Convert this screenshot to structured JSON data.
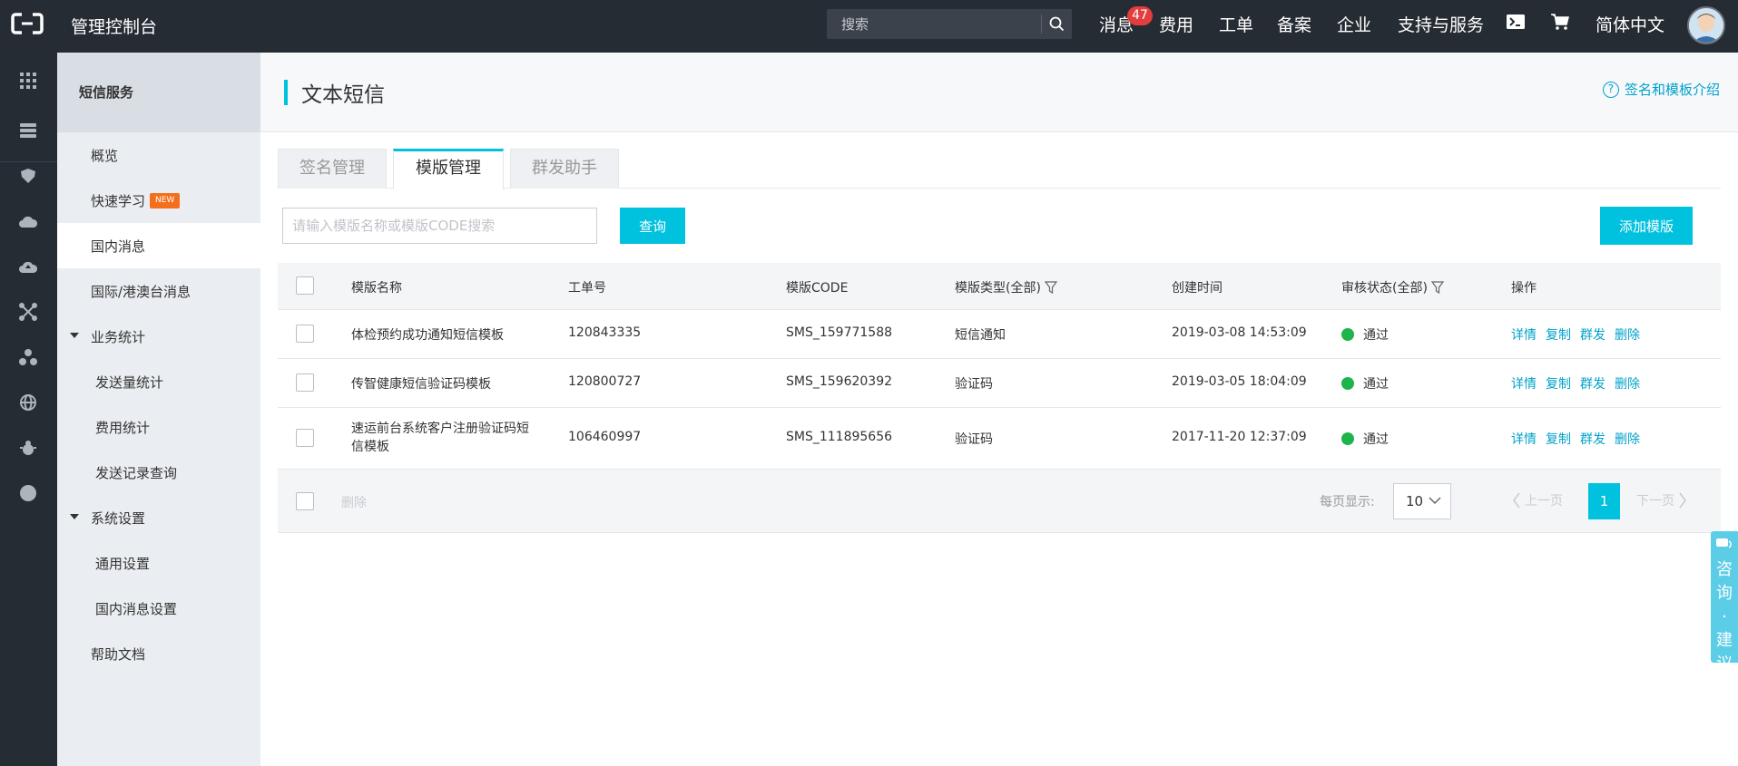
{
  "topbar": {
    "title": "管理控制台",
    "search_placeholder": "搜索",
    "nav": {
      "messages": "消息",
      "messages_count": "47",
      "billing": "费用",
      "tickets": "工单",
      "icp": "备案",
      "enterprise": "企业",
      "support": "支持与服务",
      "language": "简体中文"
    }
  },
  "sidebar": {
    "header": "短信服务",
    "items": [
      {
        "label": "概览"
      },
      {
        "label": "快速学习",
        "badge": "NEW"
      },
      {
        "label": "国内消息"
      },
      {
        "label": "国际/港澳台消息"
      },
      {
        "label": "业务统计"
      },
      {
        "label": "发送量统计"
      },
      {
        "label": "费用统计"
      },
      {
        "label": "发送记录查询"
      },
      {
        "label": "系统设置"
      },
      {
        "label": "通用设置"
      },
      {
        "label": "国内消息设置"
      },
      {
        "label": "帮助文档"
      }
    ]
  },
  "main": {
    "title": "文本短信",
    "help_link": "签名和模板介绍",
    "tabs": [
      "签名管理",
      "模版管理",
      "群发助手"
    ],
    "search_placeholder": "请输入模版名称或模版CODE搜索",
    "query_button": "查询",
    "add_button": "添加模版",
    "table": {
      "headers": [
        "模版名称",
        "工单号",
        "模版CODE",
        "模版类型(全部)",
        "创建时间",
        "审核状态(全部)",
        "操作"
      ],
      "rows": [
        {
          "name": "体检预约成功通知短信模板",
          "ticket": "120843335",
          "code": "SMS_159771588",
          "type": "短信通知",
          "created": "2019-03-08 14:53:09",
          "status": "通过"
        },
        {
          "name": "传智健康短信验证码模板",
          "ticket": "120800727",
          "code": "SMS_159620392",
          "type": "验证码",
          "created": "2019-03-05 18:04:09",
          "status": "通过"
        },
        {
          "name": "速运前台系统客户注册验证码短信模板",
          "ticket": "106460997",
          "code": "SMS_111895656",
          "type": "验证码",
          "created": "2017-11-20 12:37:09",
          "status": "通过"
        }
      ],
      "actions": [
        "详情",
        "复制",
        "群发",
        "删除"
      ]
    },
    "footer": {
      "delete": "删除",
      "per_page_label": "每页显示:",
      "per_page_value": "10",
      "prev": "上一页",
      "page": "1",
      "next": "下一页"
    }
  },
  "consult": "咨询·建议",
  "colors": {
    "accent": "#00c1de",
    "link": "#00a2ca",
    "topbar_bg": "#262c34",
    "status_ok": "#1db44b",
    "badge": "#e33d3d",
    "new_badge": "#f46f1c"
  }
}
